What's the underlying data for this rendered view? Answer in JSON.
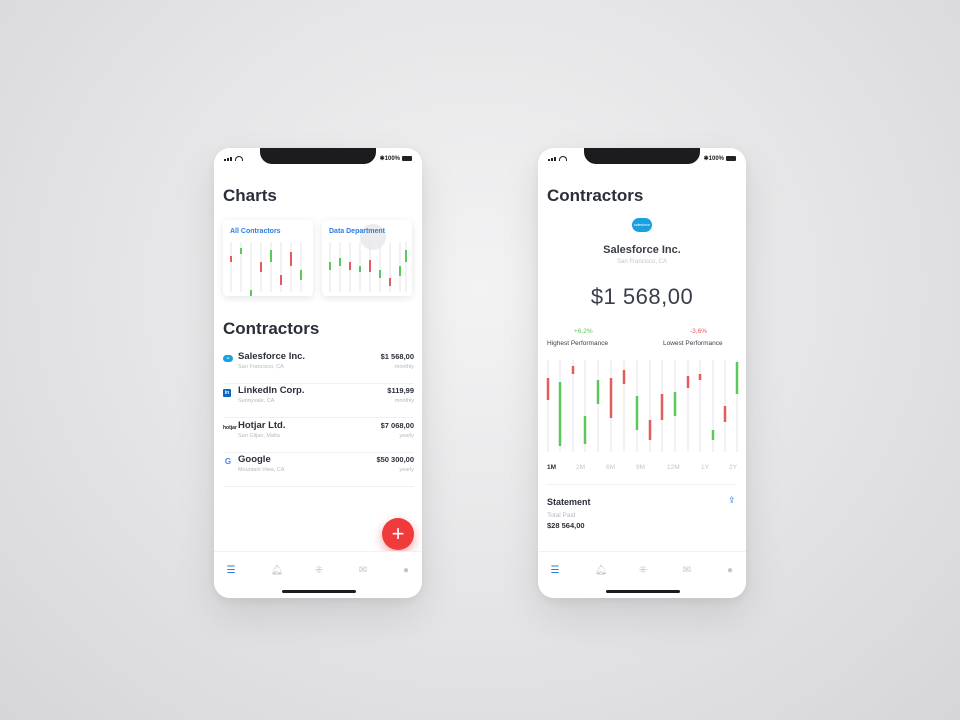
{
  "colors": {
    "accent": "#2a7de1",
    "up": "#5cc85c",
    "down": "#e35d5d",
    "fab": "#ef3b3b"
  },
  "status_bar": {
    "battery": "100%"
  },
  "left_screen": {
    "charts_title": "Charts",
    "chart_cards": [
      {
        "title": "All Contractors"
      },
      {
        "title": "Data Department"
      }
    ],
    "contractors_title": "Contractors",
    "contractors": [
      {
        "icon": "salesforce-logo",
        "name": "Salesforce Inc.",
        "location": "San Francisco, CA",
        "amount": "$1 568,00",
        "period": "monthly"
      },
      {
        "icon": "linkedin-logo",
        "name": "LinkedIn Corp.",
        "location": "Sunnyvale, CA",
        "amount": "$119,99",
        "period": "monthly"
      },
      {
        "icon": "hotjar-logo",
        "name": "Hotjar Ltd.",
        "location": "San Giljan, Malta",
        "amount": "$7 068,00",
        "period": "yearly"
      },
      {
        "icon": "google-logo",
        "name": "Google",
        "location": "Mountain View, CA",
        "amount": "$50 300,00",
        "period": "yearly"
      }
    ],
    "fab_symbol": "+"
  },
  "right_screen": {
    "title": "Contractors",
    "logo_text": "salesforce",
    "company": "Salesforce Inc.",
    "location": "San Francisco, CA",
    "amount": "$1 568,00",
    "highest": {
      "value": "+6,2%",
      "label": "Highest Performance"
    },
    "lowest": {
      "value": "-3,6%",
      "label": "Lowest Performance"
    },
    "ranges": [
      "1M",
      "2M",
      "6M",
      "9M",
      "12M",
      "1Y",
      "2Y"
    ],
    "selected_range": "1M",
    "statement": {
      "title": "Statement",
      "total_label": "Total Paid",
      "total_value": "$28 564,00"
    }
  },
  "tab_bar": {
    "tabs": [
      {
        "icon": "list-icon",
        "active": true
      },
      {
        "icon": "bell-icon",
        "active": false
      },
      {
        "icon": "grid-icon",
        "active": false
      },
      {
        "icon": "mail-icon",
        "active": false
      },
      {
        "icon": "user-icon",
        "active": false
      }
    ]
  }
}
